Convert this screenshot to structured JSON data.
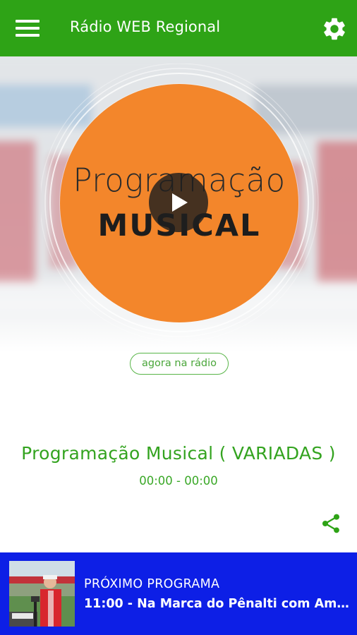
{
  "app": {
    "title": "Rádio WEB Regional",
    "colors": {
      "primary": "#2ea316",
      "accent_text": "#33a31f",
      "next_bar": "#0d1fe6",
      "cover": "#f3862b"
    },
    "icons": {
      "menu": "hamburger-icon",
      "settings": "gear-icon",
      "play": "play-icon",
      "share": "share-icon"
    }
  },
  "player": {
    "cover_line1": "Programação",
    "cover_line2": "MUSICAL",
    "now_badge": "agora na rádio",
    "program_title": "Programação Musical ( VARIADAS )",
    "program_time": "00:00 - 00:00"
  },
  "next_program": {
    "label": "PRÓXIMO PROGRAMA",
    "text": "11:00 - Na Marca do Pênalti com Amad..."
  }
}
